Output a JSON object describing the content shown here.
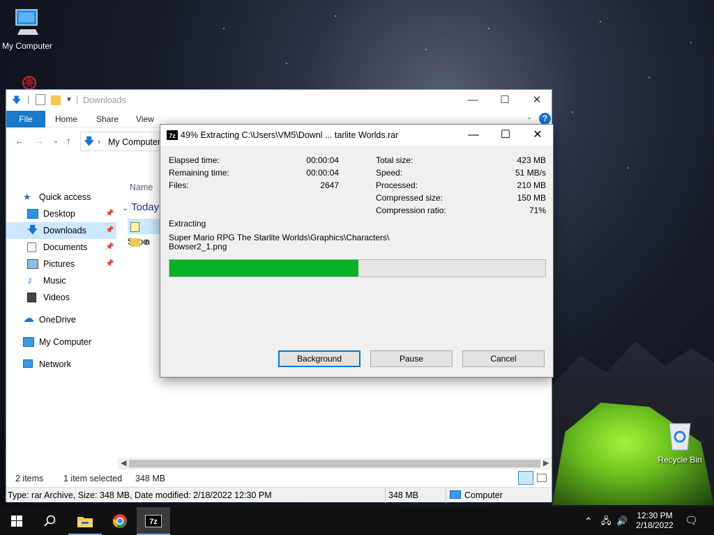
{
  "desktop": {
    "icons": [
      {
        "label": "My Computer"
      },
      {
        "label": "Recycle Bin"
      }
    ]
  },
  "explorer": {
    "title": "Downloads",
    "ribbon_tabs": [
      "File",
      "Home",
      "Share",
      "View"
    ],
    "address": "My Computer",
    "column_name": "Name",
    "group_today": "Today",
    "files": [
      "Supe",
      "a"
    ],
    "sidebar": [
      {
        "label": "Quick access",
        "icon": "star-icon"
      },
      {
        "label": "Desktop",
        "icon": "desktop-icon",
        "pinned": true
      },
      {
        "label": "Downloads",
        "icon": "download-icon",
        "pinned": true,
        "selected": true
      },
      {
        "label": "Documents",
        "icon": "documents-icon",
        "pinned": true
      },
      {
        "label": "Pictures",
        "icon": "pictures-icon",
        "pinned": true
      },
      {
        "label": "Music",
        "icon": "music-icon"
      },
      {
        "label": "Videos",
        "icon": "videos-icon"
      },
      {
        "label": "OneDrive",
        "icon": "cloud-icon"
      },
      {
        "label": "My Computer",
        "icon": "computer-icon"
      },
      {
        "label": "Network",
        "icon": "network-icon"
      }
    ],
    "status": {
      "items": "2 items",
      "selected": "1 item selected",
      "size": "348 MB"
    },
    "details_bar": {
      "info": "Type: rar Archive, Size: 348 MB, Date modified: 2/18/2022 12:30 PM",
      "size": "348 MB",
      "location": "Computer"
    }
  },
  "dialog": {
    "icon_text": "7z",
    "title": "49% Extracting C:\\Users\\VM5\\Downl ... tarlite Worlds.rar",
    "left": [
      {
        "label": "Elapsed time:",
        "value": "00:00:04"
      },
      {
        "label": "Remaining time:",
        "value": "00:00:04"
      },
      {
        "label": "Files:",
        "value": "2647"
      }
    ],
    "right": [
      {
        "label": "Total size:",
        "value": "423 MB"
      },
      {
        "label": "Speed:",
        "value": "51 MB/s"
      },
      {
        "label": "Processed:",
        "value": "210 MB"
      },
      {
        "label": "Compressed size:",
        "value": "150 MB"
      },
      {
        "label": "Compression ratio:",
        "value": "71%"
      }
    ],
    "extracting_label": "Extracting",
    "path_line1": "Super Mario RPG The Starlite Worlds\\Graphics\\Characters\\",
    "path_line2": "Bowser2_1.png",
    "progress_percent": 49,
    "buttons": {
      "background": "Background",
      "pause": "Pause",
      "cancel": "Cancel"
    }
  },
  "taskbar": {
    "apps": [
      "windows-start-icon",
      "search-icon",
      "file-explorer-icon",
      "chrome-icon",
      "7zip-icon"
    ],
    "app_7z_text": "7z",
    "time": "12:30 PM",
    "date": "2/18/2022"
  },
  "colors": {
    "accent": "#0078d7",
    "file_tab": "#1979ca",
    "progress": "#06b025",
    "selection": "#cce8ff"
  }
}
